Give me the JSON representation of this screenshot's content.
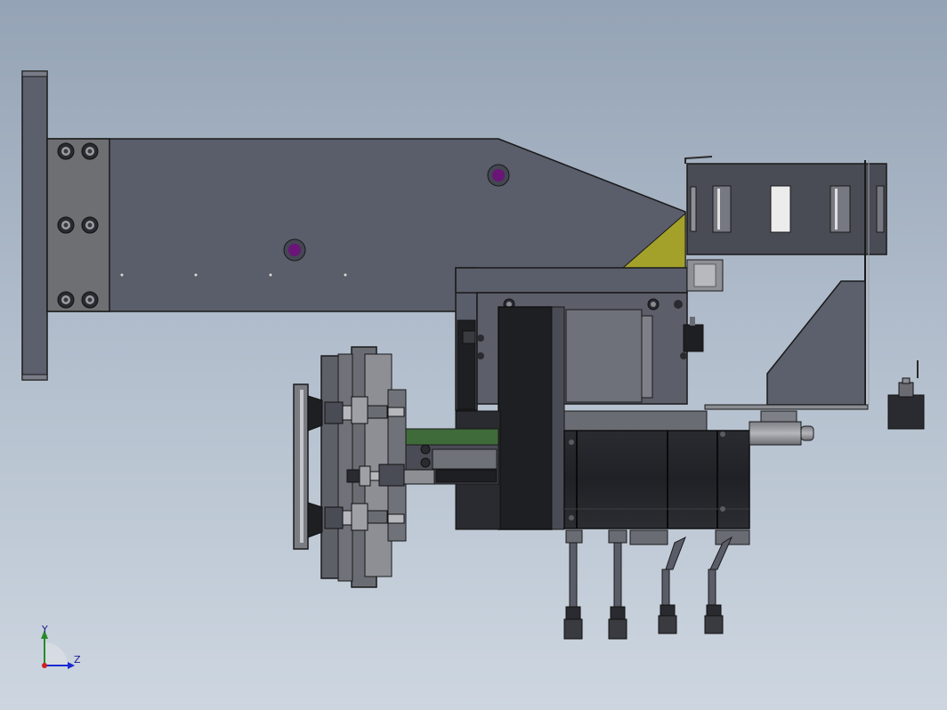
{
  "triad": {
    "y_label": "Y",
    "z_label": "Z"
  },
  "colors": {
    "body": "#5a5d6a",
    "body_dark": "#3f424c",
    "plate": "#6a6c74",
    "plate_light": "#8d8f95",
    "green": "#3f6b3a",
    "olive": "#a3a12a",
    "purple": "#6a1577",
    "black": "#1e1f23",
    "outline": "#1a1a1a",
    "axis_y": "#2a8a2a",
    "axis_z": "#1a2ad0",
    "origin": "#d02020"
  }
}
